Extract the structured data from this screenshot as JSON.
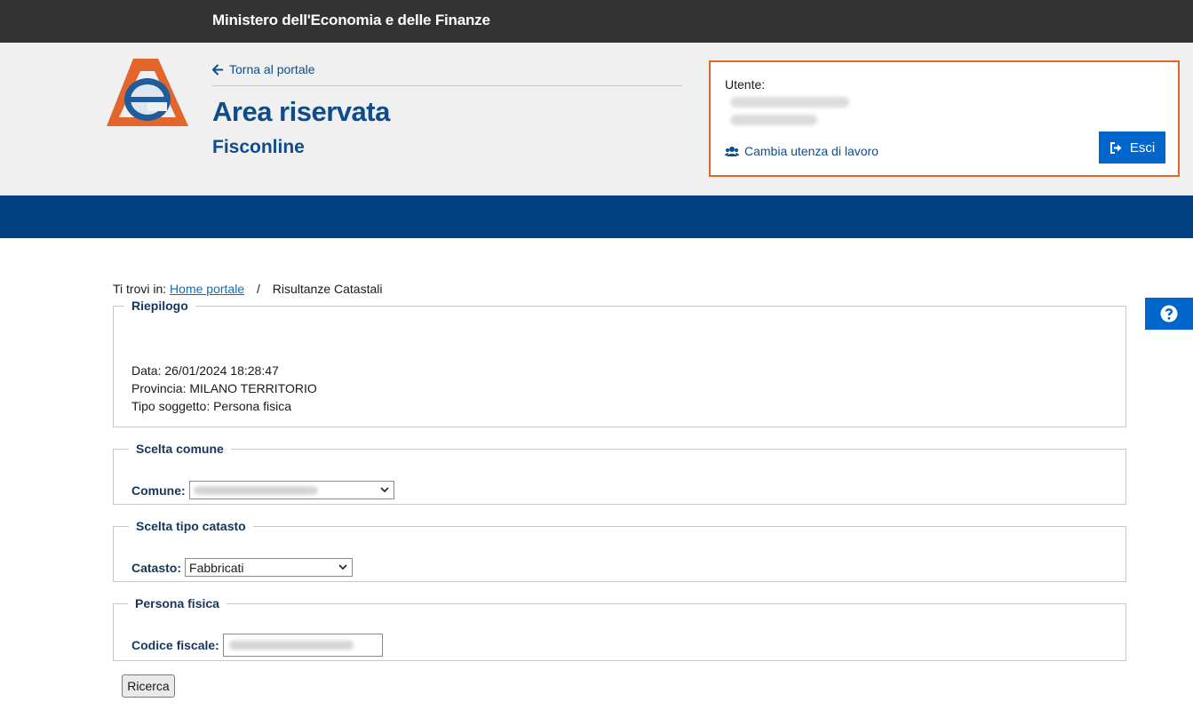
{
  "topbar": {
    "ministry": "Ministero dell'Economia e delle Finanze"
  },
  "header": {
    "back_link": "Torna al portale",
    "title": "Area riservata",
    "subtitle": "Fisconline",
    "user_label": "Utente:",
    "switch_link": "Cambia utenza di lavoro",
    "logout_label": "Esci"
  },
  "breadcrumb": {
    "prefix": "Ti trovi in:",
    "home": "Home portale",
    "separator": "/",
    "current": "Risultanze Catastali"
  },
  "riepilogo": {
    "legend": "Riepilogo",
    "data": "Data: 26/01/2024 18:28:47",
    "provincia": "Provincia: MILANO TERRITORIO",
    "tipo_soggetto": "Tipo soggetto: Persona fisica"
  },
  "scelta_comune": {
    "legend": "Scelta comune",
    "label": "Comune:"
  },
  "scelta_catasto": {
    "legend": "Scelta tipo catasto",
    "label": "Catasto:",
    "selected": "Fabbricati"
  },
  "persona_fisica": {
    "legend": "Persona fisica",
    "label": "Codice fiscale:"
  },
  "actions": {
    "search_label": "Ricerca"
  },
  "colors": {
    "primary_blue": "#004080",
    "accent_orange": "#e2652c",
    "button_blue": "#0066cc"
  }
}
